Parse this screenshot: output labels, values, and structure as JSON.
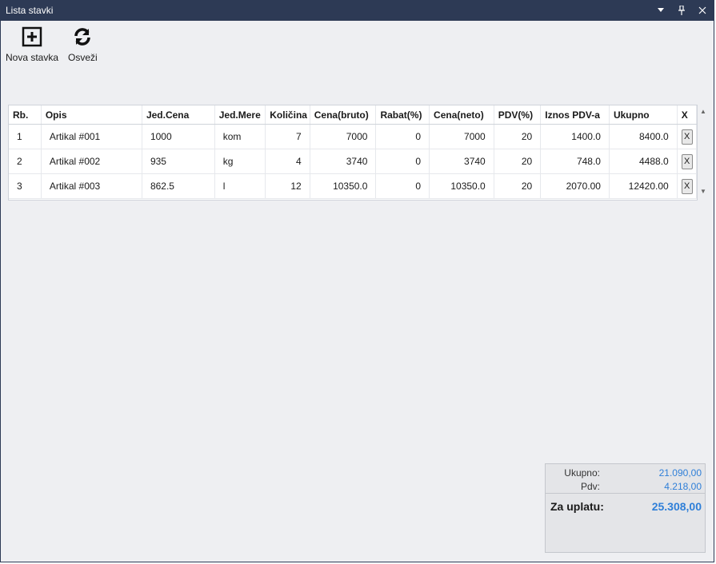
{
  "window": {
    "title": "Lista stavki"
  },
  "toolbar": {
    "new_label": "Nova stavka",
    "refresh_label": "Osveži"
  },
  "grid": {
    "columns": [
      "Rb.",
      "Opis",
      "Jed.Cena",
      "Jed.Mere",
      "Količina",
      "Cena(bruto)",
      "Rabat(%)",
      "Cena(neto)",
      "PDV(%)",
      "Iznos PDV-a",
      "Ukupno",
      "X"
    ],
    "rows": [
      {
        "rb": "1",
        "opis": "Artikal #001",
        "jed_cena": "1000",
        "jed_mere": "kom",
        "kolicina": "7",
        "cena_bruto": "7000",
        "rabat": "0",
        "cena_neto": "7000",
        "pdv": "20",
        "iznos_pdv": "1400.0",
        "ukupno": "8400.0",
        "x": "X"
      },
      {
        "rb": "2",
        "opis": "Artikal #002",
        "jed_cena": "935",
        "jed_mere": "kg",
        "kolicina": "4",
        "cena_bruto": "3740",
        "rabat": "0",
        "cena_neto": "3740",
        "pdv": "20",
        "iznos_pdv": "748.0",
        "ukupno": "4488.0",
        "x": "X"
      },
      {
        "rb": "3",
        "opis": "Artikal #003",
        "jed_cena": "862.5",
        "jed_mere": "l",
        "kolicina": "12",
        "cena_bruto": "10350.0",
        "rabat": "0",
        "cena_neto": "10350.0",
        "pdv": "20",
        "iznos_pdv": "2070.00",
        "ukupno": "12420.00",
        "x": "X"
      }
    ]
  },
  "summary": {
    "ukupno_label": "Ukupno:",
    "ukupno_value": "21.090,00",
    "pdv_label": "Pdv:",
    "pdv_value": "4.218,00",
    "za_uplatu_label": "Za uplatu:",
    "za_uplatu_value": "25.308,00"
  },
  "colors": {
    "titlebar": "#2d3a55",
    "accent_value": "#2f7fd8",
    "background": "#eeeff2"
  },
  "icons": {
    "new": "plus-square-icon",
    "refresh": "refresh-icon"
  }
}
